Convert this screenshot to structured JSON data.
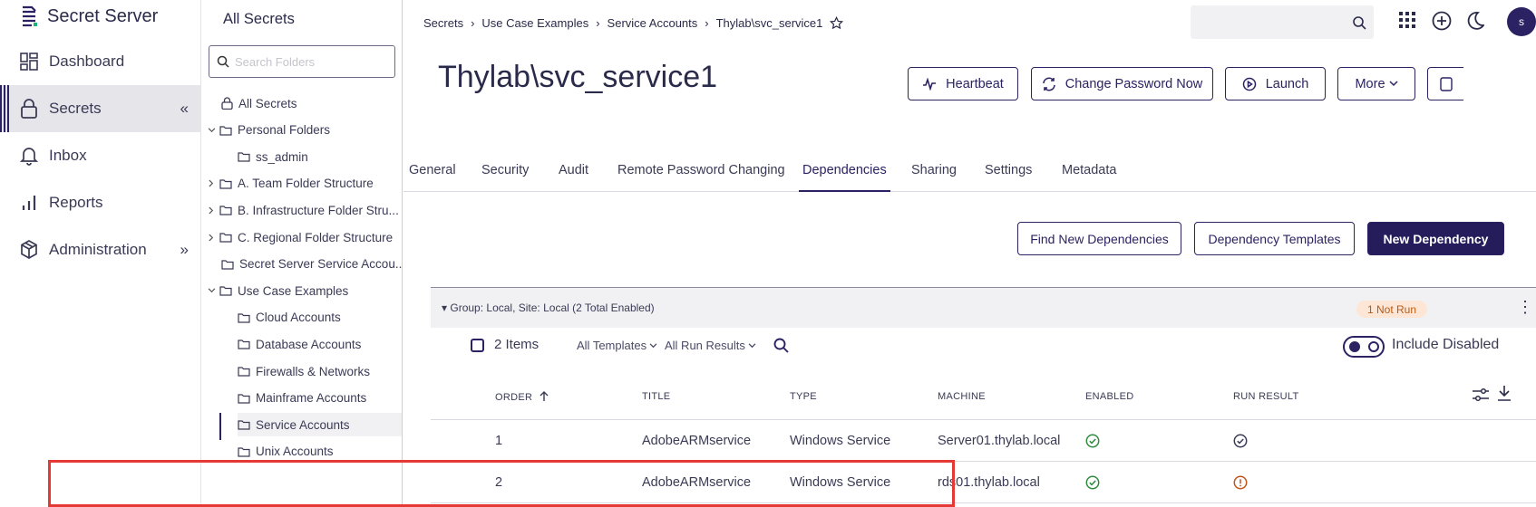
{
  "app": {
    "name": "Secret Server"
  },
  "nav": {
    "items": [
      {
        "label": "Dashboard",
        "icon": "dashboard-icon"
      },
      {
        "label": "Secrets",
        "icon": "lock-icon",
        "chevron": "«"
      },
      {
        "label": "Inbox",
        "icon": "bell-icon"
      },
      {
        "label": "Reports",
        "icon": "bar-chart-icon"
      },
      {
        "label": "Administration",
        "icon": "cube-icon",
        "chevron": "»"
      }
    ]
  },
  "folders": {
    "title": "All Secrets",
    "search_placeholder": "Search Folders",
    "tree": [
      {
        "label": "All Secrets",
        "icon": "lock-icon",
        "twisty": ""
      },
      {
        "label": "Personal Folders",
        "icon": "folder-icon",
        "twisty": "⌄"
      },
      {
        "label": "ss_admin",
        "icon": "folder-icon",
        "twisty": ""
      },
      {
        "label": "A. Team Folder Structure",
        "icon": "folder-icon",
        "twisty": "›"
      },
      {
        "label": "B. Infrastructure Folder Stru...",
        "icon": "folder-icon",
        "twisty": "›"
      },
      {
        "label": "C. Regional Folder Structure",
        "icon": "folder-icon",
        "twisty": "›"
      },
      {
        "label": "Secret Server Service Accou...",
        "icon": "folder-icon",
        "twisty": ""
      },
      {
        "label": "Use Case Examples",
        "icon": "folder-icon",
        "twisty": "⌄"
      },
      {
        "label": "Cloud Accounts",
        "icon": "folder-icon",
        "twisty": ""
      },
      {
        "label": "Database Accounts",
        "icon": "folder-icon",
        "twisty": ""
      },
      {
        "label": "Firewalls & Networks",
        "icon": "folder-icon",
        "twisty": ""
      },
      {
        "label": "Mainframe Accounts",
        "icon": "folder-icon",
        "twisty": ""
      },
      {
        "label": "Service Accounts",
        "icon": "folder-icon",
        "twisty": ""
      },
      {
        "label": "Unix Accounts",
        "icon": "folder-icon",
        "twisty": ""
      }
    ]
  },
  "breadcrumb": [
    "Secrets",
    "Use Case Examples",
    "Service Accounts",
    "Thylab\\svc_service1"
  ],
  "header": {
    "title": "Thylab\\svc_service1",
    "buttons": {
      "heartbeat": "Heartbeat",
      "change_password": "Change Password Now",
      "launch": "Launch",
      "more": "More"
    },
    "avatar_initial": "s"
  },
  "tabs": [
    "General",
    "Security",
    "Audit",
    "Remote Password Changing",
    "Dependencies",
    "Sharing",
    "Settings",
    "Metadata"
  ],
  "active_tab": "Dependencies",
  "dependency_actions": {
    "find": "Find New Dependencies",
    "templates": "Dependency Templates",
    "new": "New Dependency"
  },
  "group": {
    "label": "Group: Local, Site: Local (2 Total Enabled)",
    "badge": "1 Not Run"
  },
  "toolbar": {
    "items_count": "2 Items",
    "filter_templates": "All Templates",
    "filter_results": "All Run Results",
    "include_disabled": "Include Disabled"
  },
  "table": {
    "columns": [
      "ORDER",
      "TITLE",
      "TYPE",
      "MACHINE",
      "ENABLED",
      "RUN RESULT"
    ],
    "rows": [
      {
        "order": "1",
        "title": "AdobeARMservice",
        "type": "Windows Service",
        "machine": "Server01.thylab.local",
        "enabled": "check-circle-icon",
        "run_result": "check-circle-icon"
      },
      {
        "order": "2",
        "title": "AdobeARMservice",
        "type": "Windows Service",
        "machine": "rds01.thylab.local",
        "enabled": "check-circle-icon",
        "run_result": "info-circle-icon"
      }
    ]
  },
  "colors": {
    "primary": "#251c5c",
    "success": "#2e8b3e",
    "warning": "#c0541a",
    "highlight": "#e53935"
  }
}
